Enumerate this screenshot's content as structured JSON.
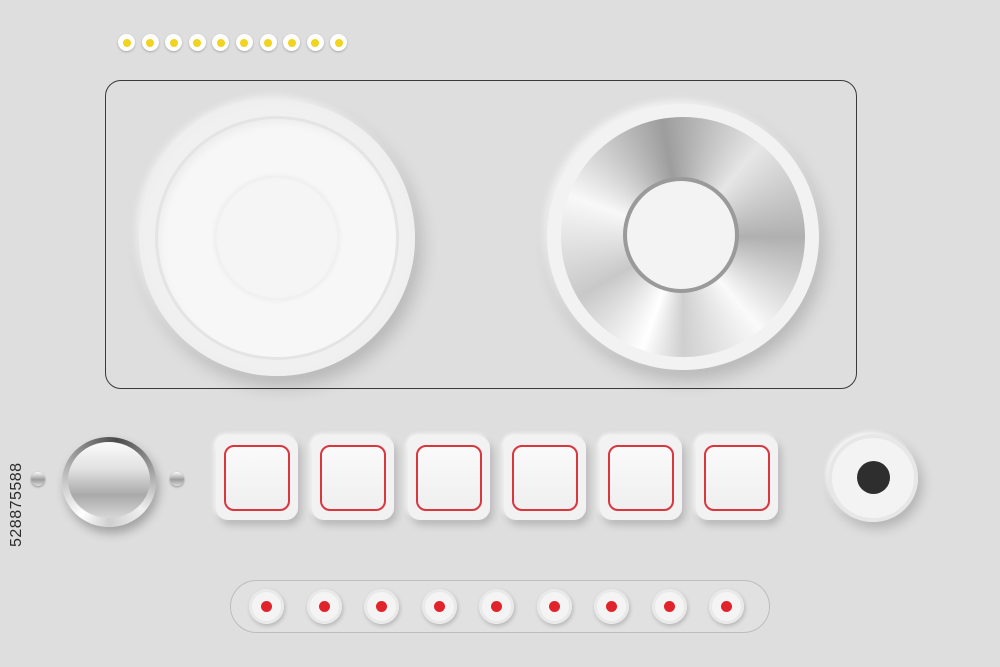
{
  "top_indicators": {
    "count": 10,
    "led_color": "#f2d31e"
  },
  "deck": {
    "left_platter": {
      "icon": "white-jog-wheel"
    },
    "right_platter": {
      "icon": "chrome-jog-wheel"
    }
  },
  "controls": {
    "knob": {
      "icon": "chrome-rotary-knob"
    },
    "pads": {
      "count": 6,
      "border_color": "#d9363e"
    },
    "round_button": {
      "icon": "black-dot-button"
    }
  },
  "bottom_indicators": {
    "count": 9,
    "led_color": "#e1242b"
  },
  "stock_id": "528875588",
  "colors": {
    "background": "#dedede",
    "panel_border": "#3a3a3a"
  }
}
